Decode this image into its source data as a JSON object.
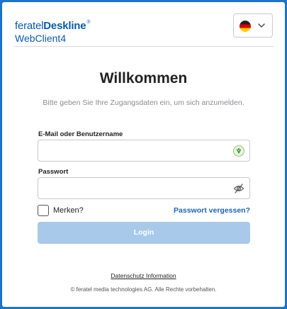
{
  "brand": {
    "name_light": "feratel",
    "name_bold": "Deskline",
    "trademark": "®",
    "subtitle": "WebClient4"
  },
  "language_selector": {
    "icon": "german-flag-icon",
    "dropdown_icon": "chevron-down-icon"
  },
  "heading": {
    "title": "Willkommen",
    "subtitle": "Bitte geben Sie Ihre Zugangsdaten ein, um sich anzumelden."
  },
  "form": {
    "username_label": "E-Mail oder Benutzername",
    "username_value": "",
    "username_icon": "password-manager-icon",
    "password_label": "Passwort",
    "password_value": "",
    "password_icon": "eye-slash-icon",
    "remember_label": "Merken?",
    "remember_checked": false,
    "forgot_link": "Passwort vergessen?",
    "login_button": "Login"
  },
  "footer": {
    "privacy_link": "Datenschutz Information",
    "copyright": "© feratel media technologies AG. Alle Rechte vorbehalten."
  },
  "colors": {
    "background": "#1e73c8",
    "brand": "#0b5cab",
    "link": "#1a66b8",
    "login_button_disabled": "#a8c9ea"
  }
}
